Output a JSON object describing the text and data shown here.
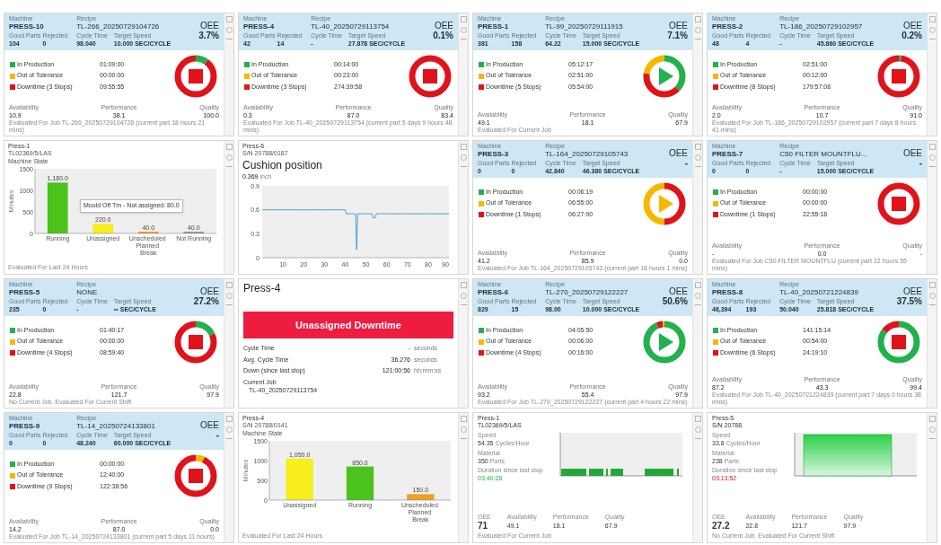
{
  "cards": [
    {
      "kind": "oee",
      "machine_label": "Machine",
      "machine": "PRESS-10",
      "recipe_label": "Recipe",
      "recipe": "TL-266_20250729104726",
      "oee_label": "OEE",
      "oee": "3.7%",
      "stats": [
        {
          "label": "Good Parts",
          "value": "104"
        },
        {
          "label": "Rejected",
          "value": "0"
        },
        {
          "label": "Cycle Time",
          "value": "98.040"
        },
        {
          "label": "Target Speed",
          "value": "10.000 SEC/CYCLE"
        }
      ],
      "legend": [
        {
          "label": "In Production",
          "time": "01:09:00",
          "color": "#22b14c"
        },
        {
          "label": "Out of Tolerance",
          "time": "00:00:00",
          "color": "#f5b800"
        },
        {
          "label": "Downtime (3 Stops)",
          "time": "09:55:55",
          "color": "#e0131b"
        }
      ],
      "donut": [
        {
          "color": "#22b14c",
          "level": 0.1
        },
        {
          "color": "#e0131b",
          "level": 0.9
        }
      ],
      "status": {
        "kind": "stopped"
      },
      "metrics": [
        {
          "label": "Availability",
          "value": "10.9"
        },
        {
          "label": "Performance",
          "value": "38.1"
        },
        {
          "label": "Quality",
          "value": "100.0"
        }
      ],
      "note": "Evaluated For Job TL-266_20250729104726 (current part 18 hours 21 mins)"
    },
    {
      "kind": "oee",
      "machine_label": "Machine",
      "machine": "PRESS-4",
      "recipe_label": "Recipe",
      "recipe": "TL-40_20250729113754",
      "oee_label": "OEE",
      "oee": "0.1%",
      "stats": [
        {
          "label": "Good Parts",
          "value": "42"
        },
        {
          "label": "Rejected",
          "value": "14"
        },
        {
          "label": "Cycle Time",
          "value": "-"
        },
        {
          "label": "Target Speed",
          "value": "27.878 SEC/CYCLE"
        }
      ],
      "legend": [
        {
          "label": "In Production",
          "time": "00:14:00",
          "color": "#22b14c"
        },
        {
          "label": "Out of Tolerance",
          "time": "00:23:00",
          "color": "#f5b800"
        },
        {
          "label": "Downtime (3 Stops)",
          "time": "274:39:58",
          "color": "#e0131b"
        }
      ],
      "donut": [
        {
          "color": "#e0131b",
          "level": 1
        }
      ],
      "status": {
        "kind": "stopped"
      },
      "metrics": [
        {
          "label": "Availability",
          "value": "0.3"
        },
        {
          "label": "Performance",
          "value": "87.0"
        },
        {
          "label": "Quality",
          "value": "83.4"
        }
      ],
      "note": "Evaluated For Job TL-40_20250729113754 (current part 5 days 9 hours 48 mins)"
    },
    {
      "kind": "oee",
      "machine_label": "Machine",
      "machine": "PRESS-1",
      "recipe_label": "Recipe",
      "recipe": "TL-99_20250729111915",
      "oee_label": "OEE",
      "oee": "7.1%",
      "stats": [
        {
          "label": "Good Parts",
          "value": "381"
        },
        {
          "label": "Rejected",
          "value": "158"
        },
        {
          "label": "Cycle Time",
          "value": "64.22"
        },
        {
          "label": "Target Speed",
          "value": "15.000 SEC/CYCLE"
        }
      ],
      "legend": [
        {
          "label": "In Production",
          "time": "05:12:17",
          "color": "#22b14c"
        },
        {
          "label": "Out of Tolerance",
          "time": "02:51:00",
          "color": "#f5b800"
        },
        {
          "label": "Downtime (5 Stops)",
          "time": "05:54:00",
          "color": "#e0131b"
        }
      ],
      "donut": [
        {
          "color": "#22b14c",
          "level": 0.37
        },
        {
          "color": "#e0131b",
          "level": 0.4
        },
        {
          "color": "#f5b800",
          "level": 0.23
        }
      ],
      "status": {
        "kind": "running"
      },
      "metrics": [
        {
          "label": "Availability",
          "value": "49.1"
        },
        {
          "label": "Performance",
          "value": "18.1"
        },
        {
          "label": "Quality",
          "value": "67.9"
        }
      ],
      "note": "Evaluated For Current Job"
    },
    {
      "kind": "oee",
      "machine_label": "Machine",
      "machine": "PRESS-2",
      "recipe_label": "Recipe",
      "recipe": "TL-186_20250729102957",
      "oee_label": "OEE",
      "oee": "0.2%",
      "stats": [
        {
          "label": "Good Parts",
          "value": "48"
        },
        {
          "label": "Rejected",
          "value": "4"
        },
        {
          "label": "Cycle Time",
          "value": "-"
        },
        {
          "label": "Target Speed",
          "value": "45.860 SEC/CYCLE"
        }
      ],
      "legend": [
        {
          "label": "In Production",
          "time": "02:51:00",
          "color": "#22b14c"
        },
        {
          "label": "Out of Tolerance",
          "time": "00:12:00",
          "color": "#f5b800"
        },
        {
          "label": "Downtime (8 Stops)",
          "time": "179:57:08",
          "color": "#e0131b"
        }
      ],
      "donut": [
        {
          "color": "#22b14c",
          "level": 0.02
        },
        {
          "color": "#e0131b",
          "level": 0.98
        }
      ],
      "status": {
        "kind": "stopped"
      },
      "metrics": [
        {
          "label": "Availability",
          "value": "2.0"
        },
        {
          "label": "Performance",
          "value": "10.7"
        },
        {
          "label": "Quality",
          "value": "91.0"
        }
      ],
      "note": "Evaluated For Job TL-186_20250729102957 (current part 7 days 8 hours 41 mins)"
    },
    {
      "kind": "bar_chart",
      "title": "Press-1",
      "subtitle": "TL02369/5/LAS",
      "chart_title": "Machine State",
      "bars": [
        {
          "color": "#4cc21c"
        },
        {
          "color": "#f7ee1c"
        },
        {
          "color": "#f0a020"
        },
        {
          "color": "#9a9a9a"
        }
      ],
      "tooltip": "Mould Off Tm - Not assigned: 80.0",
      "chart_data": {
        "type": "bar",
        "ylabel": "Minutes",
        "categories": [
          "Running",
          "Unassigned",
          "Unscheduled Planned Break",
          "Not Running"
        ],
        "values": [
          1180,
          220,
          40,
          40
        ],
        "value_labels": [
          "1,180.0",
          "220.0",
          "40.0",
          "40.0"
        ],
        "ylim": [
          0,
          1500
        ],
        "yticks": [
          0,
          500,
          1000,
          1500
        ]
      },
      "note": "Evaluated For Last 24 Hours"
    },
    {
      "kind": "line_chart",
      "title": "Press-6",
      "subtitle": "S/N 20788/0187",
      "chart_title": "Cushion position",
      "reading": "0.369",
      "unit": "inch",
      "chart_data": {
        "type": "line",
        "x": [
          0,
          10,
          20,
          30,
          40,
          40.5,
          45,
          45.5,
          46,
          50,
          53,
          53.5,
          54.5,
          55,
          60,
          70,
          80,
          90
        ],
        "series": [
          {
            "color": "#3a9ad9",
            "values": [
              0.6,
              0.6,
              0.6,
              0.6,
              0.6,
              0.55,
              0.55,
              0.1,
              0.55,
              0.55,
              0.55,
              0.5,
              0.5,
              0.55,
              0.55,
              0.55,
              0.55,
              0.55
            ]
          }
        ],
        "xlim": [
          0,
          90
        ],
        "ylim": [
          0,
          0.9
        ],
        "yticks": [
          0,
          0.3,
          0.6,
          0.9
        ],
        "xticks": [
          10,
          20,
          30,
          40,
          50,
          60,
          70,
          80,
          90
        ]
      }
    },
    {
      "kind": "oee",
      "machine_label": "Machine",
      "machine": "PRESS-3",
      "recipe_label": "Recipe",
      "recipe": "TL-164_20250729105743",
      "oee_label": "OEE",
      "oee": "-",
      "stats": [
        {
          "label": "Good Parts",
          "value": "0"
        },
        {
          "label": "Rejected",
          "value": "0"
        },
        {
          "label": "Cycle Time",
          "value": "42.840"
        },
        {
          "label": "Target Speed",
          "value": "46.380 SEC/CYCLE"
        }
      ],
      "legend": [
        {
          "label": "In Production",
          "time": "00:06:19",
          "color": "#22b14c"
        },
        {
          "label": "Out of Tolerance",
          "time": "06:55:00",
          "color": "#f5b800"
        },
        {
          "label": "Downtime (1 Stops)",
          "time": "06:27:00",
          "color": "#e0131b"
        }
      ],
      "donut": [
        {
          "color": "#e0131b",
          "level": 0.5
        },
        {
          "color": "#f5b800",
          "level": 0.5
        }
      ],
      "status": {
        "kind": "warning"
      },
      "metrics": [
        {
          "label": "Availability",
          "value": "41.2"
        },
        {
          "label": "Performance",
          "value": "85.9"
        },
        {
          "label": "Quality",
          "value": "0.0"
        }
      ],
      "note": "Evaluated For Job TL-164_20250729105743 (current part 18 hours 1 mins)"
    },
    {
      "kind": "oee",
      "machine_label": "Machine",
      "machine": "PRESS-7",
      "recipe_label": "Recipe",
      "recipe": "C50 FILTER MOUNTFLU...",
      "oee_label": "OEE",
      "oee": "-",
      "stats": [
        {
          "label": "Good Parts",
          "value": "0"
        },
        {
          "label": "Rejected",
          "value": "0"
        },
        {
          "label": "Cycle Time",
          "value": "-"
        },
        {
          "label": "Target Speed",
          "value": "15.000 SEC/CYCLE"
        }
      ],
      "legend": [
        {
          "label": "In Production",
          "time": "00:00:00",
          "color": "#22b14c"
        },
        {
          "label": "Out of Tolerance",
          "time": "00:00:00",
          "color": "#f5b800"
        },
        {
          "label": "Downtime (1 Stops)",
          "time": "22:55:18",
          "color": "#e0131b"
        }
      ],
      "donut": [
        {
          "color": "#e0131b",
          "level": 1
        }
      ],
      "status": {
        "kind": "stopped"
      },
      "metrics": [
        {
          "label": "Availability",
          "value": "-"
        },
        {
          "label": "Performance",
          "value": "0.0"
        },
        {
          "label": "Quality",
          "value": "-"
        }
      ],
      "note": "Evaluated For Job C50 FILTER MOUNTFLU (current part 22 hours 55 mins)"
    },
    {
      "kind": "oee",
      "machine_label": "Machine",
      "machine": "PRESS-5",
      "recipe_label": "Recipe",
      "recipe": "NONE",
      "oee_label": "OEE",
      "oee": "27.2%",
      "stats": [
        {
          "label": "Good Parts",
          "value": "235"
        },
        {
          "label": "Rejected",
          "value": "0"
        },
        {
          "label": "Cycle Time",
          "value": "-"
        },
        {
          "label": "Target Speed",
          "value": "∞ SEC/CYCLE"
        }
      ],
      "legend": [
        {
          "label": "In Production",
          "time": "01:40:17",
          "color": "#22b14c"
        },
        {
          "label": "Out of Tolerance",
          "time": "00:00:00",
          "color": "#f5b800"
        },
        {
          "label": "Downtime (4 Stops)",
          "time": "08:59:40",
          "color": "#e0131b"
        }
      ],
      "donut": [
        {
          "color": "#22b14c",
          "level": 0.18
        },
        {
          "color": "#e0131b",
          "level": 0.82
        }
      ],
      "status": {
        "kind": "stopped"
      },
      "metrics": [
        {
          "label": "Availability",
          "value": "22.8"
        },
        {
          "label": "Performance",
          "value": "121.7"
        },
        {
          "label": "Quality",
          "value": "97.9"
        }
      ],
      "note": "No Current Job. Evaluated For Current Shift"
    },
    {
      "kind": "downtime",
      "title": "Press-4",
      "banner": "Unassigned Downtime",
      "rows": [
        {
          "label": "Cycle Time",
          "value": "-",
          "unit": "seconds"
        },
        {
          "label": "Avg. Cycle Time",
          "value": "36.276",
          "unit": "seconds"
        },
        {
          "label": "Down (since last stop)",
          "value": "121:00:56",
          "unit": "hh:mm:ss"
        }
      ],
      "job_label": "Current Job",
      "job": "TL-40_20250729113754"
    },
    {
      "kind": "oee",
      "machine_label": "Machine",
      "machine": "PRESS-6",
      "recipe_label": "Recipe",
      "recipe": "TL-270_20250729122227",
      "oee_label": "OEE",
      "oee": "50.6%",
      "stats": [
        {
          "label": "Good Parts",
          "value": "829"
        },
        {
          "label": "Rejected",
          "value": "15"
        },
        {
          "label": "Cycle Time",
          "value": "98.00"
        },
        {
          "label": "Target Speed",
          "value": "10.000 SEC/CYCLE"
        }
      ],
      "legend": [
        {
          "label": "In Production",
          "time": "04:05:50",
          "color": "#22b14c"
        },
        {
          "label": "Out of Tolerance",
          "time": "00:06:00",
          "color": "#f5b800"
        },
        {
          "label": "Downtime (4 Stops)",
          "time": "00:16:00",
          "color": "#e0131b"
        }
      ],
      "donut": [
        {
          "color": "#22b14c",
          "level": 0.93
        },
        {
          "color": "#e0131b",
          "level": 0.05
        },
        {
          "color": "#f5b800",
          "level": 0.02
        }
      ],
      "status": {
        "kind": "running"
      },
      "metrics": [
        {
          "label": "Availability",
          "value": "93.2"
        },
        {
          "label": "Performance",
          "value": "55.4"
        },
        {
          "label": "Quality",
          "value": "97.9"
        }
      ],
      "note": "Evaluated For Job TL-270_20250729122227 (current part 4 hours 22 mins)"
    },
    {
      "kind": "oee",
      "machine_label": "Machine",
      "machine": "PRESS-8",
      "recipe_label": "Recipe",
      "recipe": "TL-40_20250721224839",
      "oee_label": "OEE",
      "oee": "37.5%",
      "stats": [
        {
          "label": "Good Parts",
          "value": "46,394"
        },
        {
          "label": "Rejected",
          "value": "193"
        },
        {
          "label": "Cycle Time",
          "value": "50.040"
        },
        {
          "label": "Target Speed",
          "value": "25.818 SEC/CYCLE"
        }
      ],
      "legend": [
        {
          "label": "In Production",
          "time": "141:15:14",
          "color": "#22b14c"
        },
        {
          "label": "Out of Tolerance",
          "time": "00:54:00",
          "color": "#f5b800"
        },
        {
          "label": "Downtime (6 Stops)",
          "time": "24:19:10",
          "color": "#e0131b"
        }
      ],
      "donut": [
        {
          "color": "#22b14c",
          "level": 0.85
        },
        {
          "color": "#e0131b",
          "level": 0.15
        }
      ],
      "status": {
        "kind": "stopped"
      },
      "metrics": [
        {
          "label": "Availability",
          "value": "87.2"
        },
        {
          "label": "Performance",
          "value": "43.3"
        },
        {
          "label": "Quality",
          "value": "99.4"
        }
      ],
      "note": "Evaluated For Job TL-40_20250721224839 (current part 7 days 0 hours 38 mins)"
    },
    {
      "kind": "oee",
      "machine_label": "Machine",
      "machine": "PRESS-9",
      "recipe_label": "Recipe",
      "recipe": "TL-14_20250724133801",
      "oee_label": "OEE",
      "oee": "-",
      "stats": [
        {
          "label": "Good Parts",
          "value": "0"
        },
        {
          "label": "Rejected",
          "value": "0"
        },
        {
          "label": "Cycle Time",
          "value": "48.240"
        },
        {
          "label": "Target Speed",
          "value": "60.000 SEC/CYCLE"
        }
      ],
      "legend": [
        {
          "label": "In Production",
          "time": "00:00:00",
          "color": "#22b14c"
        },
        {
          "label": "Out of Tolerance",
          "time": "12:40:00",
          "color": "#f5b800"
        },
        {
          "label": "Downtime (9 Stops)",
          "time": "122:38:56",
          "color": "#e0131b"
        }
      ],
      "donut": [
        {
          "color": "#f5b800",
          "level": 0.07
        },
        {
          "color": "#e0131b",
          "level": 0.93
        }
      ],
      "status": {
        "kind": "stopped"
      },
      "metrics": [
        {
          "label": "Availability",
          "value": "14.2"
        },
        {
          "label": "Performance",
          "value": "87.0"
        },
        {
          "label": "Quality",
          "value": "0.0"
        }
      ],
      "note": "Evaluated For Job TL-14_20250724133801 (current part 5 days 11 hours)"
    },
    {
      "kind": "bar_chart",
      "title": "Press-4",
      "subtitle": "S/N 20788/0141",
      "chart_title": "Machine State",
      "bars": [
        {
          "color": "#f7ee1c"
        },
        {
          "color": "#4cc21c"
        },
        {
          "color": "#f0a020"
        }
      ],
      "chart_data": {
        "type": "bar",
        "ylabel": "Minutes",
        "categories": [
          "Unassigned",
          "Running",
          "Unscheduled Planned Break"
        ],
        "values": [
          1050,
          850,
          150
        ],
        "value_labels": [
          "1,050.0",
          "850.0",
          "150.0"
        ],
        "ylim": [
          0,
          1500
        ],
        "yticks": [
          0,
          500,
          1000,
          1500
        ]
      },
      "note": "Evaluated For Last 24 Hours"
    },
    {
      "kind": "speed",
      "title": "Press-1",
      "subtitle": "TL02369/5/LAS",
      "stats": [
        {
          "label": "Speed",
          "value": "54.35",
          "unit": "Cycles/Hour",
          "alert": false
        },
        {
          "label": "Material",
          "value": "350",
          "unit": "Parts",
          "alert": false
        },
        {
          "label": "Duration since last stop",
          "value": "03:40:28",
          "alert": false
        }
      ],
      "chart": {
        "kind": "segments"
      },
      "metrics": [
        {
          "label": "OEE",
          "value": "71"
        },
        {
          "label": "Availability",
          "value": "49.1"
        },
        {
          "label": "Performance",
          "value": "18.1"
        },
        {
          "label": "Quality",
          "value": "67.9"
        }
      ],
      "note": "Evaluated For Current Job"
    },
    {
      "kind": "speed",
      "title": "Press-5",
      "subtitle": "S/N 20788",
      "stats": [
        {
          "label": "Speed",
          "value": "33.8",
          "unit": "Cycles/Hour",
          "alert": false
        },
        {
          "label": "Material",
          "value": "238",
          "unit": "Parts",
          "alert": false
        },
        {
          "label": "Duration since last stop",
          "value": "03:13:52",
          "alert": true
        }
      ],
      "chart": {
        "kind": "area"
      },
      "metrics": [
        {
          "label": "OEE",
          "value": "27.2"
        },
        {
          "label": "Availability",
          "value": "22.8"
        },
        {
          "label": "Performance",
          "value": "121.7"
        },
        {
          "label": "Quality",
          "value": "97.9"
        }
      ],
      "note": "No Current Job. Evaluated For Current Shift"
    }
  ]
}
